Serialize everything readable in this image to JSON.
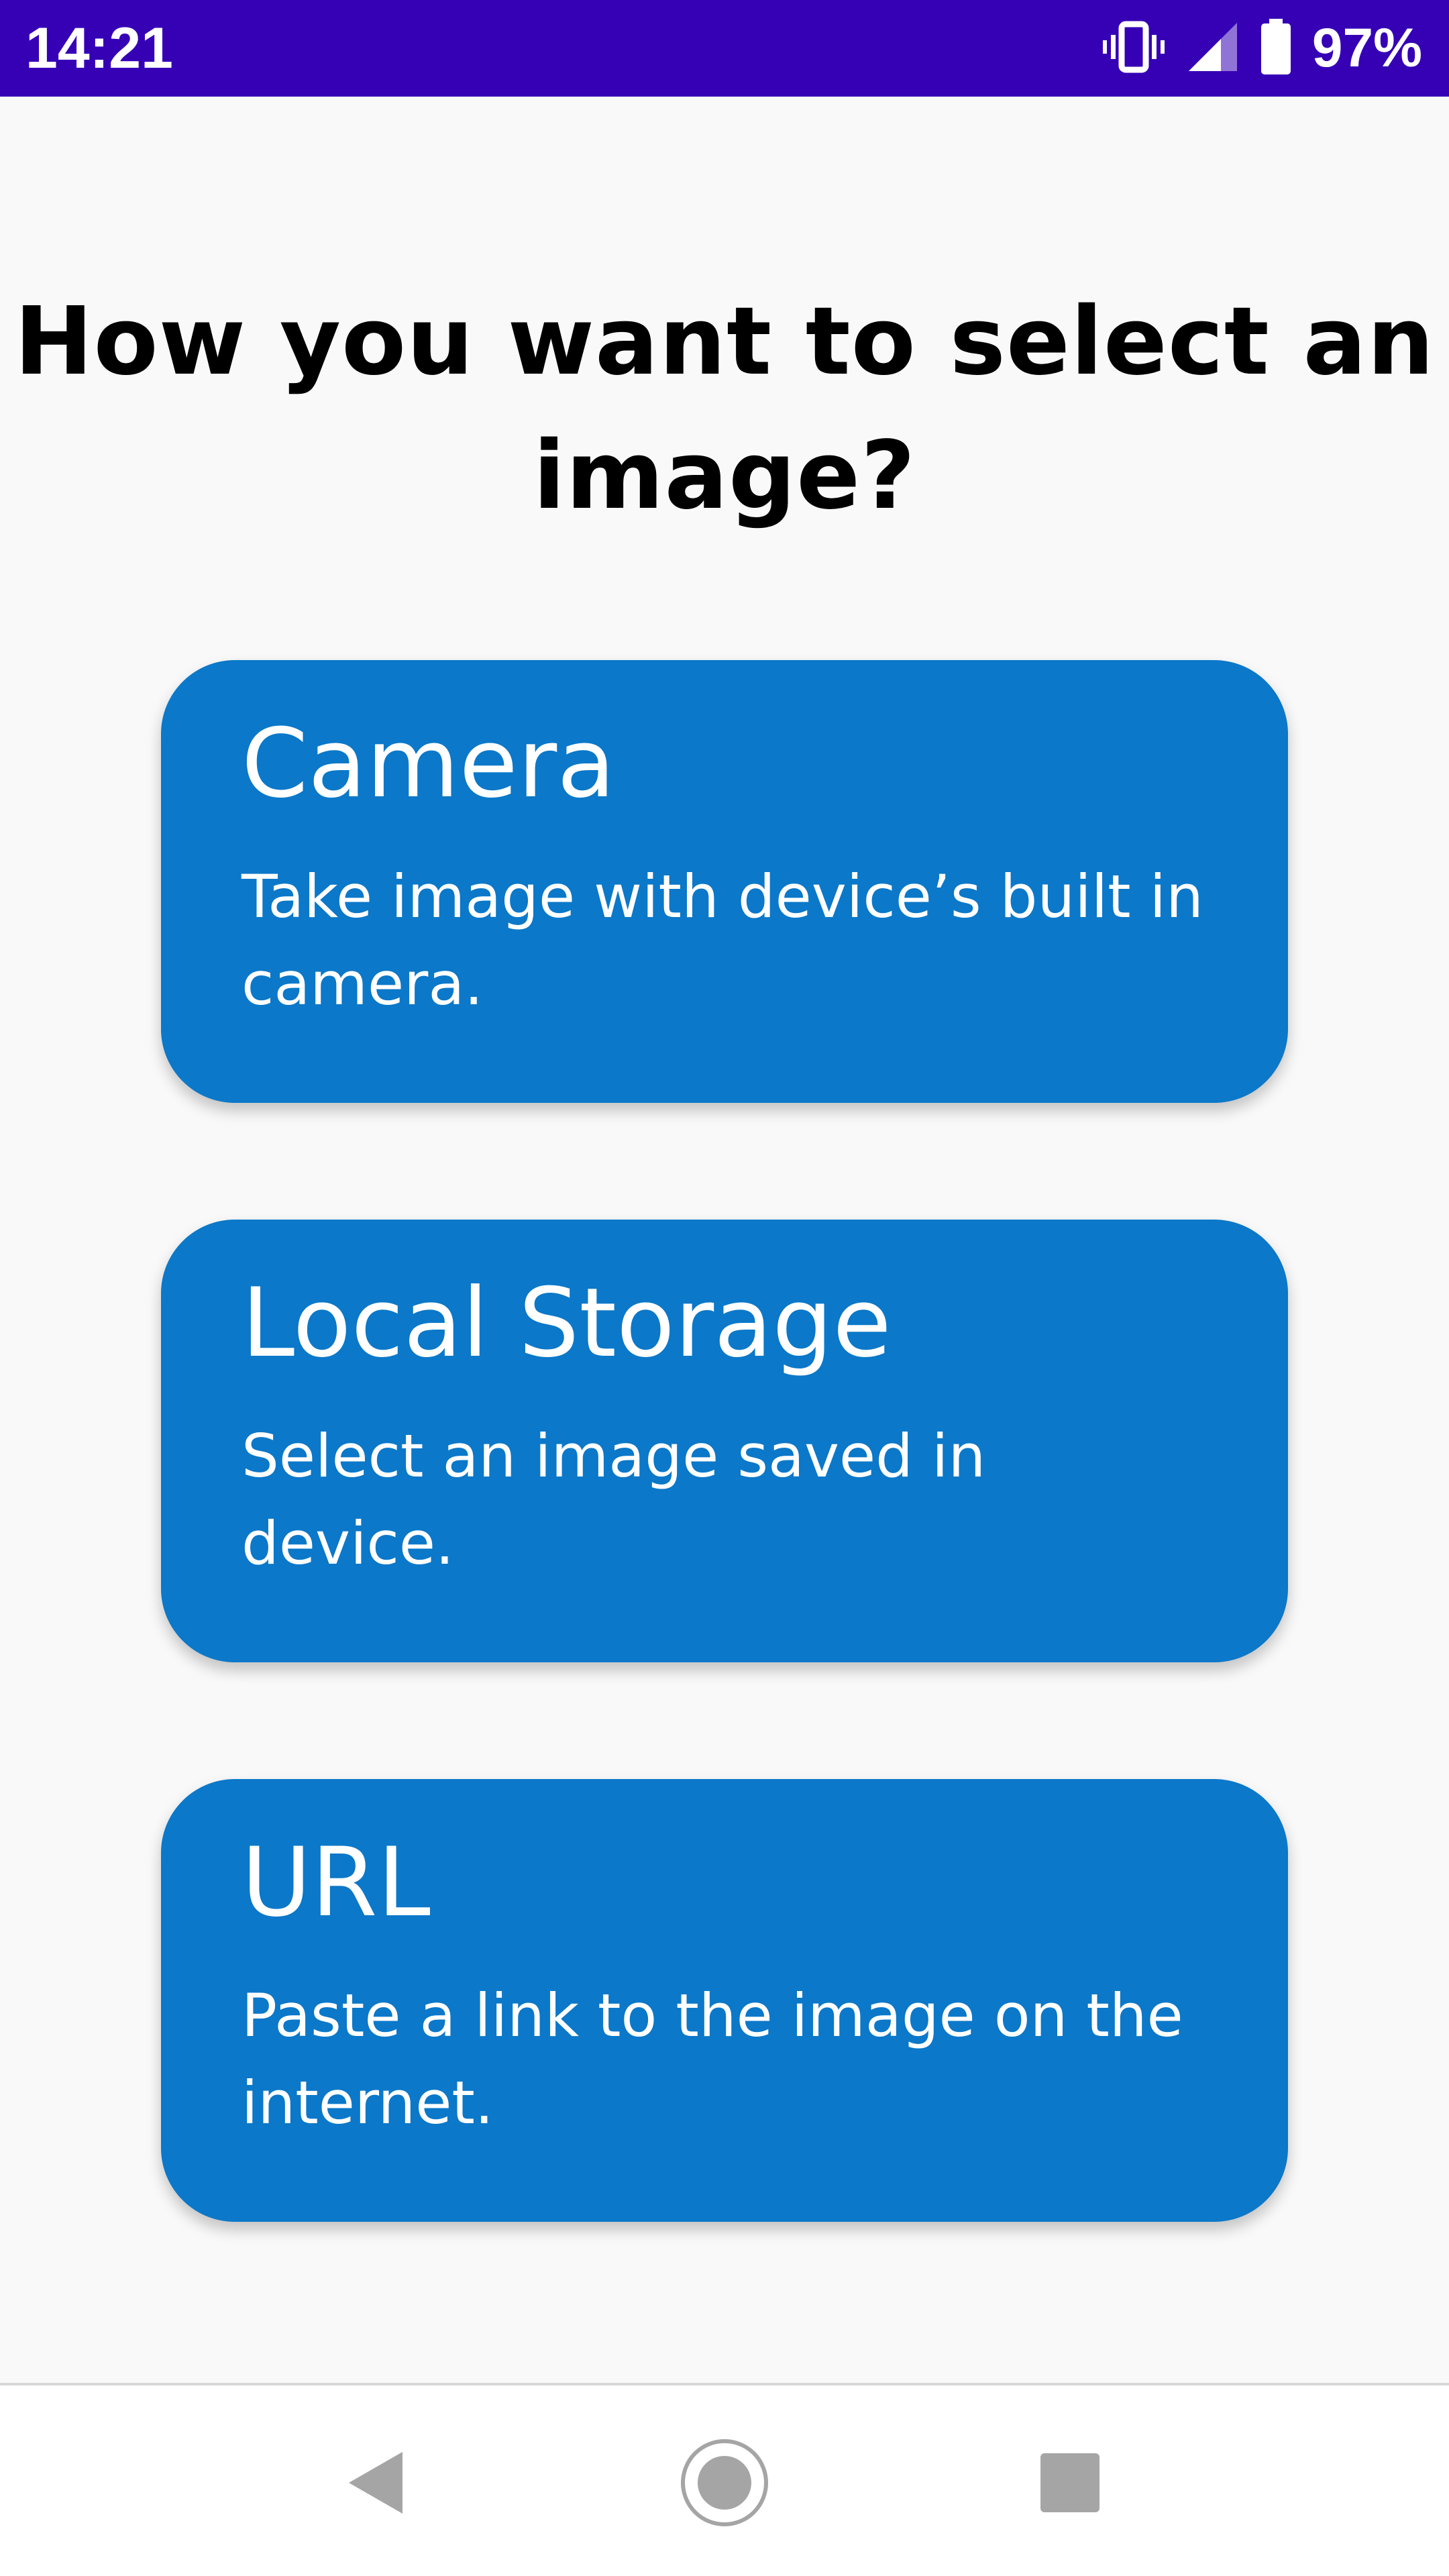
{
  "status_bar": {
    "time": "14:21",
    "battery_percent": "97%",
    "icons": [
      "vibrate-icon",
      "signal-icon",
      "battery-icon"
    ],
    "background_color": "#3600b5"
  },
  "page": {
    "title_line1": "How you want to select an",
    "title_line2": "image?",
    "background_color": "#f9f9f9"
  },
  "options": [
    {
      "title": "Camera",
      "description": "Take image with device’s built in camera."
    },
    {
      "title": "Local Storage",
      "description": "Select an image saved in device."
    },
    {
      "title": "URL",
      "description": "Paste a link to the image on the internet."
    }
  ],
  "card_color": "#0b78c9",
  "navigation_bar": {
    "buttons": [
      "back-icon",
      "home-icon",
      "recents-icon"
    ]
  }
}
